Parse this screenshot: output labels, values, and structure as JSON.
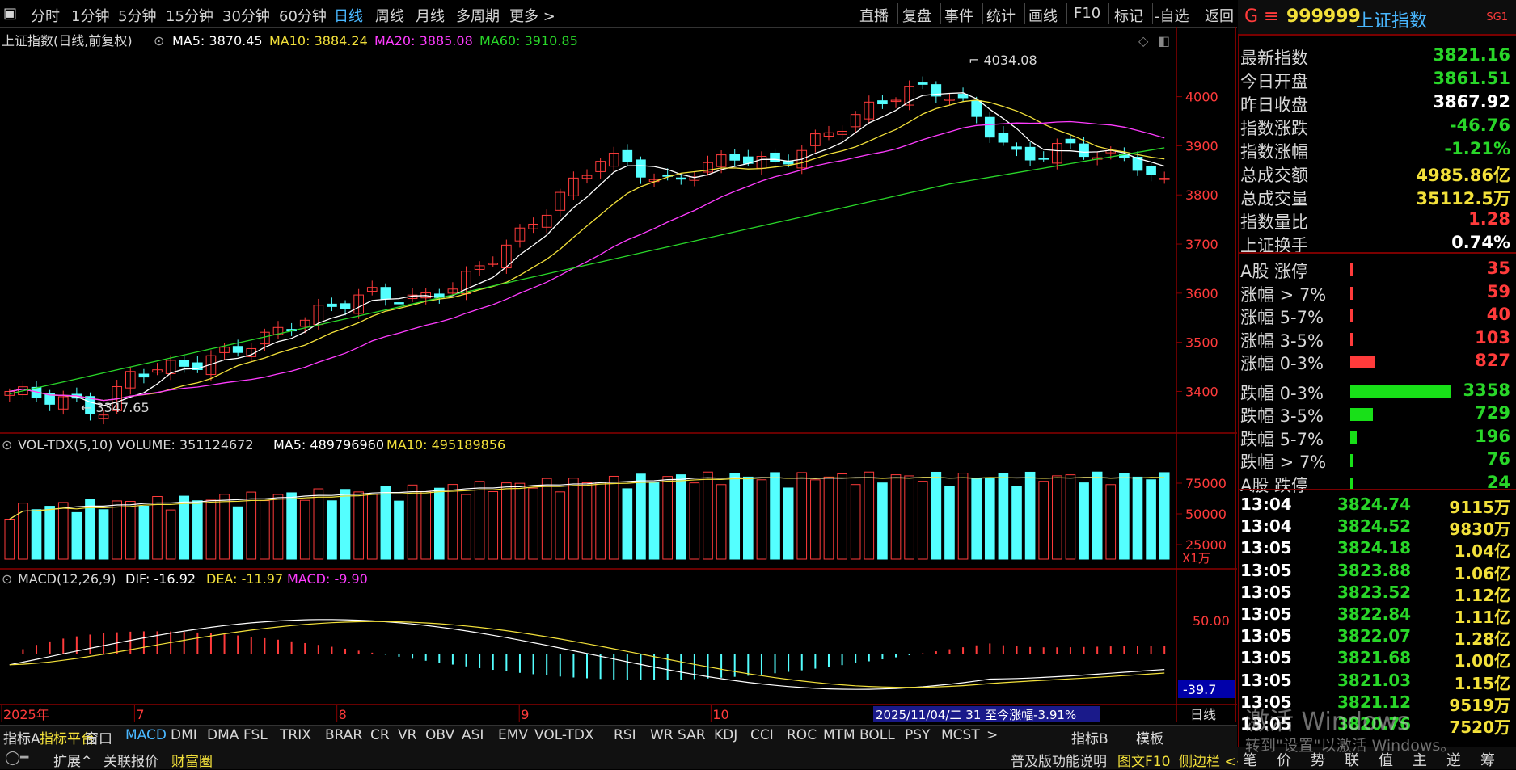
{
  "periods": [
    "分时",
    "1分钟",
    "5分钟",
    "15分钟",
    "30分钟",
    "60分钟",
    "日线",
    "周线",
    "月线",
    "多周期",
    "更多 >"
  ],
  "top_actions": [
    "直播",
    "复盘",
    "事件",
    "统计",
    "画线",
    "F10",
    "标记",
    "-自选",
    "返回"
  ],
  "chart": {
    "title": "上证指数(日线,前复权)",
    "ma_labels": [
      {
        "text": "MA5: 3870.45",
        "color": "#ffffff"
      },
      {
        "text": "MA10: 3884.24",
        "color": "#f2e03a"
      },
      {
        "text": "MA20: 3885.08",
        "color": "#ff3cff"
      },
      {
        "text": "MA60: 3910.85",
        "color": "#29d629"
      }
    ],
    "high_label": "4034.08",
    "low_label": "3347.65",
    "y_ticks": [
      "4000",
      "3900",
      "3800",
      "3700",
      "3600",
      "3500",
      "3400"
    ],
    "vol_title": "VOL-TDX(5,10) VOLUME: 351124672",
    "vol_ma5": "MA5: 489796960",
    "vol_ma10": "MA10: 495189856",
    "vol_ticks": [
      "75000",
      "50000",
      "25000"
    ],
    "vol_unit": "X1万",
    "macd_title": "MACD(12,26,9)",
    "macd_dif": "DIF: -16.92",
    "macd_dea": "DEA: -11.97",
    "macd_val": "MACD: -9.90",
    "macd_tick": "50.00",
    "macd_cursor": "-39.7",
    "x_labels": [
      {
        "text": "2025年",
        "pos": 0.0
      },
      {
        "text": "7",
        "pos": 0.113
      },
      {
        "text": "8",
        "pos": 0.285
      },
      {
        "text": "9",
        "pos": 0.44
      },
      {
        "text": "10",
        "pos": 0.603
      }
    ],
    "info_banner": "2025/11/04/二 31 至今涨幅-3.91%",
    "period_label": "日线"
  },
  "indicator_tabs": [
    "指标A",
    "指标平台",
    "窗口",
    "MACD",
    "DMI",
    "DMA",
    "FSL",
    "TRIX",
    "BRAR",
    "CR",
    "VR",
    "OBV",
    "ASI",
    "EMV",
    "VOL-TDX",
    "RSI",
    "WR",
    "SAR",
    "KDJ",
    "CCI",
    "ROC",
    "MTM",
    "BOLL",
    "PSY",
    "MCST",
    ">",
    "指标B",
    "模板"
  ],
  "status_items": [
    "扩展^",
    "关联报价",
    "财富圈"
  ],
  "status_right": [
    "普及版功能说明",
    "图文F10",
    "侧边栏 <<"
  ],
  "panel": {
    "g_label": "G ≡",
    "code": "999999",
    "name": "上证指数",
    "sg": "SG1",
    "stats": [
      {
        "label": "最新指数",
        "value": "3821.16",
        "color": "green"
      },
      {
        "label": "今日开盘",
        "value": "3861.51",
        "color": "green"
      },
      {
        "label": "昨日收盘",
        "value": "3867.92",
        "color": "white"
      },
      {
        "label": "指数涨跌",
        "value": "-46.76",
        "color": "green"
      },
      {
        "label": "指数涨幅",
        "value": "-1.21%",
        "color": "green"
      },
      {
        "label": "总成交额",
        "value": "4985.86亿",
        "color": "yellow"
      },
      {
        "label": "总成交量",
        "value": "35112.5万",
        "color": "yellow"
      },
      {
        "label": "指数量比",
        "value": "1.28",
        "color": "red"
      },
      {
        "label": "上证换手",
        "value": "0.74%",
        "color": "white"
      }
    ],
    "breadth": [
      {
        "label": "A股 涨停",
        "value": "35",
        "color": "red",
        "frac": 0.01
      },
      {
        "label": "涨幅 > 7%",
        "value": "59",
        "color": "red",
        "frac": 0.01
      },
      {
        "label": "涨幅 5-7%",
        "value": "40",
        "color": "red",
        "frac": 0.01
      },
      {
        "label": "涨幅 3-5%",
        "value": "103",
        "color": "red",
        "frac": 0.03
      },
      {
        "label": "涨幅 0-3%",
        "value": "827",
        "color": "red",
        "frac": 0.25
      },
      {
        "label": "跌幅 0-3%",
        "value": "3358",
        "color": "green",
        "frac": 1.0
      },
      {
        "label": "跌幅 3-5%",
        "value": "729",
        "color": "green",
        "frac": 0.22
      },
      {
        "label": "跌幅 5-7%",
        "value": "196",
        "color": "green",
        "frac": 0.06
      },
      {
        "label": "跌幅 > 7%",
        "value": "76",
        "color": "green",
        "frac": 0.01
      },
      {
        "label": "A股 跌停",
        "value": "24",
        "color": "green",
        "frac": 0.01
      }
    ],
    "trades": [
      {
        "time": "13:04",
        "price": "3824.74",
        "vol": "9115万"
      },
      {
        "time": "13:04",
        "price": "3824.52",
        "vol": "9830万"
      },
      {
        "time": "13:05",
        "price": "3824.18",
        "vol": "1.04亿"
      },
      {
        "time": "13:05",
        "price": "3823.88",
        "vol": "1.06亿"
      },
      {
        "time": "13:05",
        "price": "3823.52",
        "vol": "1.12亿"
      },
      {
        "time": "13:05",
        "price": "3822.84",
        "vol": "1.11亿"
      },
      {
        "time": "13:05",
        "price": "3822.07",
        "vol": "1.28亿"
      },
      {
        "time": "13:05",
        "price": "3821.68",
        "vol": "1.00亿"
      },
      {
        "time": "13:05",
        "price": "3821.03",
        "vol": "1.15亿"
      },
      {
        "time": "13:05",
        "price": "3821.12",
        "vol": "9519万"
      },
      {
        "time": "13:05",
        "price": "3820.76",
        "vol": "7520万"
      }
    ],
    "bottom_tabs": [
      "笔",
      "价",
      "势",
      "联",
      "值",
      "主",
      "逆",
      "筹"
    ]
  },
  "watermark": "激活 Windows",
  "watermark_sub": "转到\"设置\"以激活 Windows。"
}
